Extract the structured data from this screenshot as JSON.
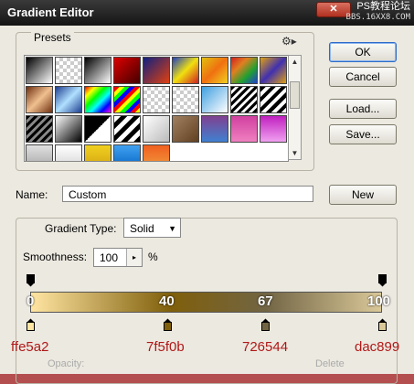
{
  "title": "Gradient Editor",
  "watermark": {
    "line1": "PS教程论坛",
    "line2": "BBS.16XX8.COM"
  },
  "presets": {
    "legend": "Presets",
    "swatches": [
      "linear-gradient(135deg,#000,#fff)",
      "repeating-conic-gradient(#ccc 0 25%,#fff 0 50%) 0 0/8px 8px",
      "linear-gradient(135deg,#000,#fff)",
      "linear-gradient(135deg,#d00,#400)",
      "linear-gradient(135deg,#102080,#e04010)",
      "linear-gradient(135deg,#2040c0,#f0e010,#d02020)",
      "linear-gradient(135deg,#e0c010,#f07010,#f0d020)",
      "linear-gradient(135deg,#d02020,#e08020,#20a030,#2040d0)",
      "linear-gradient(135deg,#e0a010,#4030b0,#e0a010)",
      "linear-gradient(135deg,#703010,#f0c090,#703010)",
      "linear-gradient(135deg,#204090,#b0e0ff,#204090)",
      "linear-gradient(135deg,#f00,#ff0,#0f0,#0ff,#00f,#f0f)",
      "repeating-linear-gradient(135deg,#f00 0 4px,#ff0 4px 8px,#0f0 8px 12px,#00f 12px 16px)",
      "repeating-conic-gradient(#ccc 0 25%,#fff 0 50%) 0 0/8px 8px",
      "repeating-conic-gradient(#ccc 0 25%,#fff 0 50%) 0 0/8px 8px",
      "linear-gradient(135deg,#40a0e0,#fff)",
      "repeating-linear-gradient(135deg,#000 0 3px,#fff 3px 6px)",
      "repeating-linear-gradient(135deg,#000 0 4px,#fff 4px 8px)",
      "repeating-linear-gradient(135deg,#000 0 3px,#888 3px 6px)",
      "linear-gradient(135deg,#fff,#000)",
      "linear-gradient(135deg,#000 50%,#fff 50%)",
      "repeating-linear-gradient(135deg,#fff 0 5px,#000 5px 10px)",
      "linear-gradient(135deg,#fff,#bbb)",
      "linear-gradient(135deg,#a08060,#604020)",
      "linear-gradient(#804090,#4080d0)",
      "linear-gradient(#d040a0,#f080c0)",
      "linear-gradient(#c020c0,#f0a0f0)",
      "linear-gradient(#e0e0e0,#a0a0a0)",
      "linear-gradient(#ffffff,#d0d0d0)",
      "linear-gradient(#f0d020,#d0a010)",
      "linear-gradient(#40a0f0,#0060c0)",
      "linear-gradient(#f06020,#f0a040)"
    ]
  },
  "buttons": {
    "ok": "OK",
    "cancel": "Cancel",
    "load": "Load...",
    "save": "Save...",
    "new": "New"
  },
  "name": {
    "label": "Name:",
    "value": "Custom"
  },
  "gradient_type": {
    "label": "Gradient Type:",
    "value": "Solid"
  },
  "smoothness": {
    "label": "Smoothness:",
    "value": "100",
    "unit": "%"
  },
  "gradient": {
    "locations": [
      "0",
      "40",
      "67",
      "100"
    ],
    "hex_labels": [
      "ffe5a2",
      "7f5f0b",
      "726544",
      "dac899"
    ],
    "colors": [
      "#ffe5a2",
      "#7f5f0b",
      "#726544",
      "#dac899"
    ]
  },
  "faded_row": {
    "opacity": "Opacity:",
    "delete": "Delete"
  }
}
